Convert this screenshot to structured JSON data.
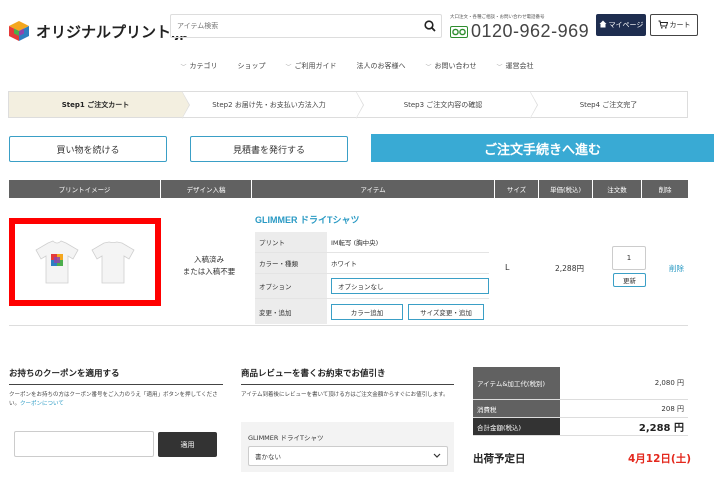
{
  "header": {
    "logo_text": "オリジナルプリント.jp",
    "search_placeholder": "アイテム検索",
    "tel_note": "大口注文・各種ご相談・お問い合わせ電話番号",
    "freedial_label": "フリーダイヤル",
    "tel_number": "0120-962-969",
    "mypage_label": "マイページ",
    "cart_label": "カート"
  },
  "nav": {
    "items": [
      {
        "label": "カテゴリ",
        "chevron": true
      },
      {
        "label": "ショップ",
        "chevron": false
      },
      {
        "label": "ご利用ガイド",
        "chevron": true
      },
      {
        "label": "法人のお客様へ",
        "chevron": false
      },
      {
        "label": "お問い合わせ",
        "chevron": true
      },
      {
        "label": "運営会社",
        "chevron": true
      }
    ]
  },
  "steps": [
    {
      "label": "Step1 ご注文カート",
      "active": true
    },
    {
      "label": "Step2 お届け先・お支払い方法入力",
      "active": false
    },
    {
      "label": "Step3 ご注文内容の確認",
      "active": false
    },
    {
      "label": "Step4 ご注文完了",
      "active": false
    }
  ],
  "actions": {
    "continue_label": "買い物を続ける",
    "estimate_label": "見積書を発行する",
    "checkout_label": "ご注文手続きへ進む"
  },
  "table": {
    "headers": {
      "image": "プリントイメージ",
      "design": "デザイン入稿",
      "item": "アイテム",
      "size": "サイズ",
      "price": "単価(税込)",
      "qty": "注文数",
      "delete": "削除"
    },
    "row": {
      "design_status_1": "入稿済み",
      "design_status_2": "または入稿不要",
      "item_name": "GLIMMER ドライTシャツ",
      "print_label": "プリント",
      "print_value": "IM転写 (胸中央)",
      "color_label": "カラー・種類",
      "color_value": "ホワイト",
      "option_label": "オプション",
      "option_value": "オプションなし",
      "change_label": "変更・追加",
      "color_add_label": "カラー追加",
      "size_change_label": "サイズ変更・追加",
      "size": "L",
      "price": "2,288円",
      "qty": "1",
      "update_label": "更新",
      "delete_label": "削除"
    }
  },
  "coupon": {
    "title": "お持ちのクーポンを適用する",
    "desc": "クーポンをお持ちの方はクーポン番号をご入力のうえ「適用」ボタンを押してください。",
    "link": "クーポンについて",
    "apply_label": "適用"
  },
  "review": {
    "title": "商品レビューを書くお約束でお値引き",
    "desc": "アイテム到着後にレビューを書いて頂ける方はご注文金額からすぐにお値引します。",
    "item_name": "GLIMMER ドライTシャツ",
    "select_value": "書かない"
  },
  "summary": {
    "subtotal_label": "アイテム&加工代(税別)",
    "subtotal_value": "2,080 円",
    "tax_label": "消費税",
    "tax_value": "208 円",
    "total_label": "合計金額(税込)",
    "total_value": "2,288 円",
    "ship_label": "出荷予定日",
    "ship_date": "4月12日(土)"
  },
  "colors": {
    "accent": "#39aad4",
    "link": "#2a9ac4",
    "header_dark": "#616161",
    "highlight_red": "#ff0000",
    "ship_date_red": "#e4281d"
  }
}
